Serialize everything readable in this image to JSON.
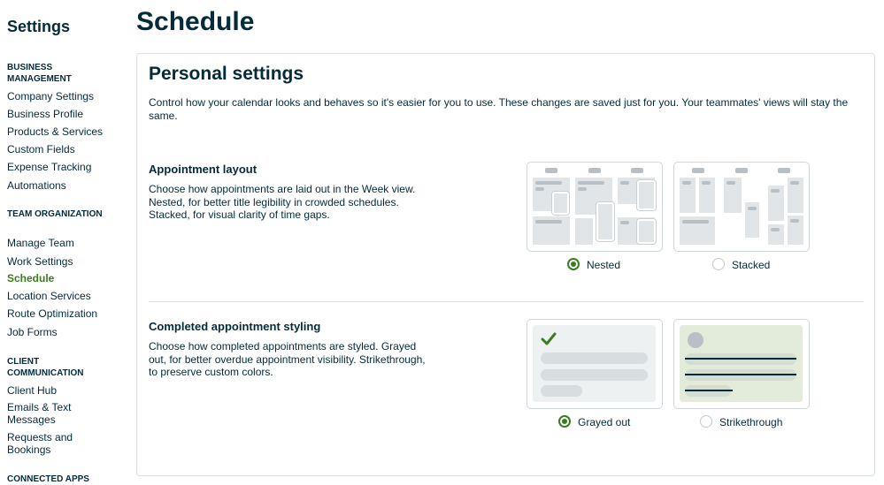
{
  "sidebar": {
    "title": "Settings",
    "sections": [
      {
        "heading": "BUSINESS MANAGEMENT",
        "items": [
          "Company Settings",
          "Business Profile",
          "Products & Services",
          "Custom Fields",
          "Expense Tracking",
          "Automations"
        ]
      },
      {
        "heading": "TEAM ORGANIZATION",
        "items": [
          "Manage Team",
          "Work Settings",
          "Schedule",
          "Location Services",
          "Route Optimization",
          "Job Forms"
        ]
      },
      {
        "heading": "CLIENT COMMUNICATION",
        "items": [
          "Client Hub",
          "Emails & Text Messages",
          "Requests and Bookings"
        ]
      },
      {
        "heading": "CONNECTED APPS",
        "items": []
      }
    ],
    "active_item": "Schedule"
  },
  "page": {
    "title": "Schedule",
    "card_title": "Personal settings",
    "card_description": "Control how your calendar looks and behaves so it's easier for you to use. These changes are saved just for you. Your teammates' views will stay the same."
  },
  "appointment_layout": {
    "title": "Appointment layout",
    "description": "Choose how appointments are laid out in the Week view. Nested, for better title legibility in crowded schedules. Stacked, for visual clarity of time gaps.",
    "options": [
      {
        "label": "Nested",
        "selected": true
      },
      {
        "label": "Stacked",
        "selected": false
      }
    ]
  },
  "completed_styling": {
    "title": "Completed appointment styling",
    "description": "Choose how completed appointments are styled. Grayed out, for better overdue appointment visibility. Strikethrough, to preserve custom colors.",
    "options": [
      {
        "label": "Grayed out",
        "selected": true
      },
      {
        "label": "Strikethrough",
        "selected": false
      }
    ]
  },
  "colors": {
    "accent_green": "#3a7d1e",
    "text_dark": "#032b3a",
    "preview_green_bg": "#e3ecdb"
  }
}
